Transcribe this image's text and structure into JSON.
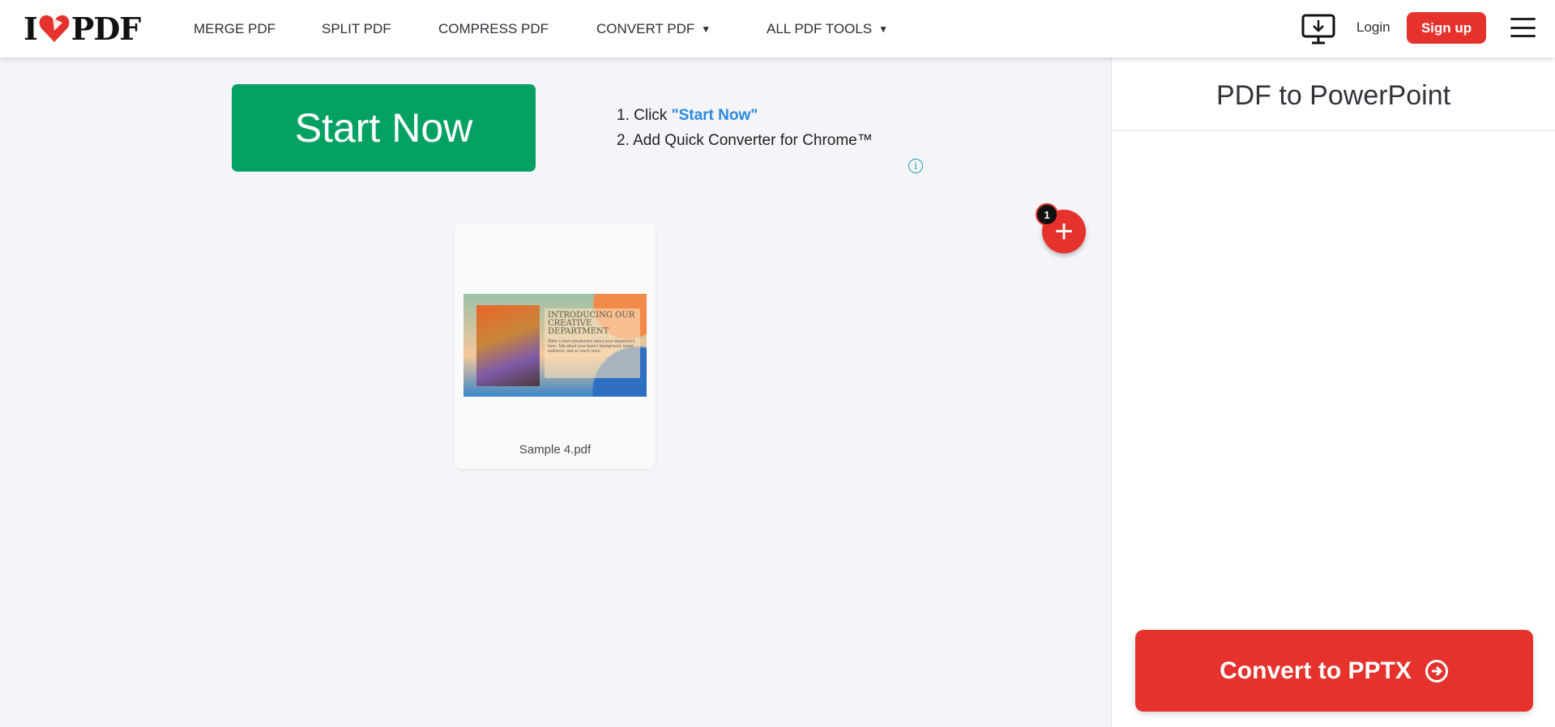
{
  "header": {
    "logo": "I ♥ PDF",
    "nav": [
      {
        "label": "MERGE PDF"
      },
      {
        "label": "SPLIT PDF"
      },
      {
        "label": "COMPRESS PDF"
      },
      {
        "label": "CONVERT PDF",
        "dropdown": true
      },
      {
        "label": "ALL PDF TOOLS",
        "dropdown": true
      }
    ],
    "caret": "▼",
    "login": "Login",
    "signup": "Sign up"
  },
  "ad": {
    "start_now": "Start Now",
    "step1_prefix": "1. Click ",
    "step1_link": "\"Start Now\"",
    "step2": "2. Add Quick Converter for Chrome™",
    "info": "i"
  },
  "files": {
    "count": "1",
    "add": "+",
    "items": [
      {
        "name": "Sample 4.pdf",
        "thumb_title": "INTRODUCING OUR CREATIVE DEPARTMENT",
        "thumb_body": "Write a short introduction about your department here. Talk about your team's background, target audience, and so much more."
      }
    ]
  },
  "sidebar": {
    "title": "PDF to PowerPoint",
    "convert": "Convert to PPTX"
  },
  "colors": {
    "brand_red": "#e5322d",
    "start_green": "#04a163",
    "link_blue": "#2a8ae0"
  }
}
